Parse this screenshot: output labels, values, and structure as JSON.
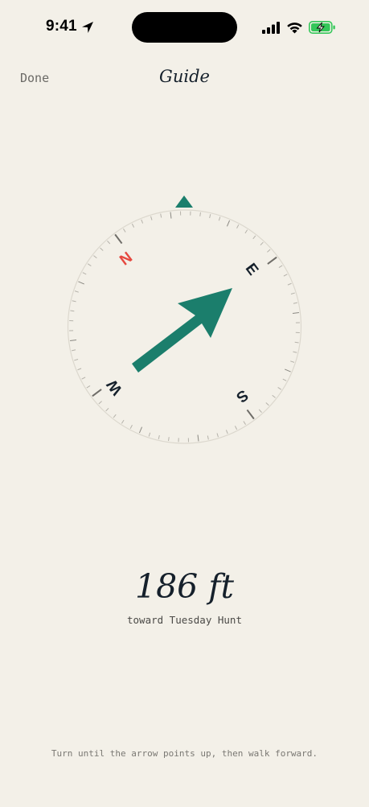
{
  "status_bar": {
    "time": "9:41",
    "icons": [
      "location-arrow-icon",
      "cellular-signal-icon",
      "wifi-icon",
      "battery-charging-icon"
    ],
    "battery_color": "#34c759"
  },
  "nav": {
    "done_label": "Done",
    "title": "Guide"
  },
  "compass": {
    "cardinals": {
      "north": "N",
      "east": "E",
      "south": "S",
      "west": "W"
    },
    "north_color": "#e5483f",
    "accent_color": "#1b7e6c",
    "icons": [
      "heading-marker-icon",
      "direction-arrow-icon"
    ]
  },
  "readout": {
    "distance": "186 ft",
    "target": "toward Tuesday Hunt"
  },
  "footer": {
    "instruction": "Turn until the arrow points up, then walk forward."
  }
}
